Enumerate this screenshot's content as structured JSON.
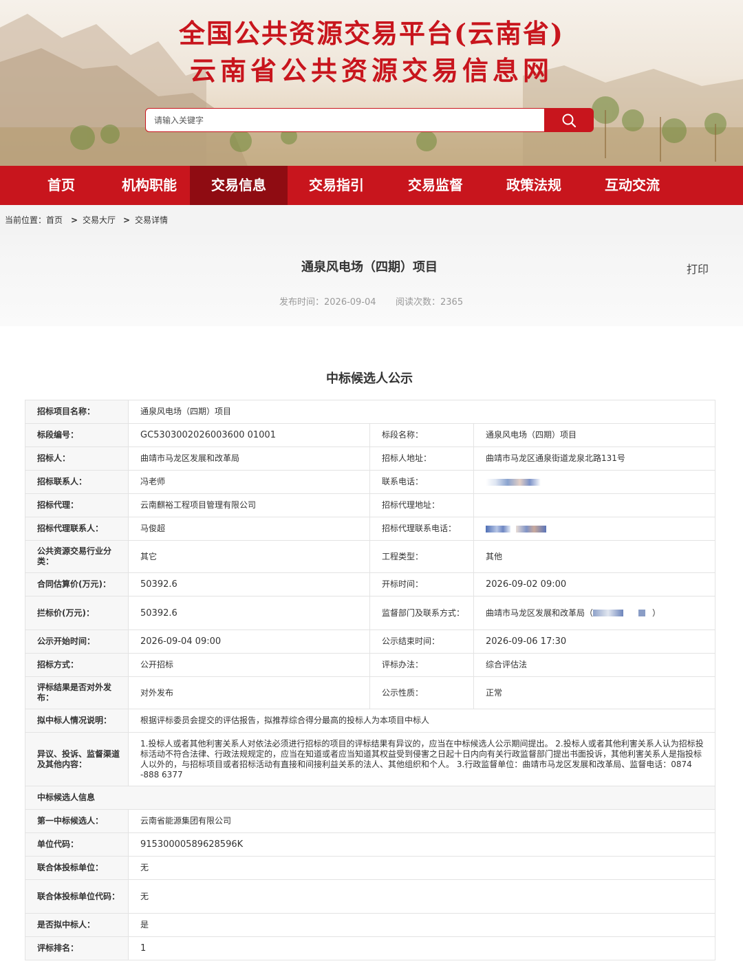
{
  "header": {
    "title_line1": "全国公共资源交易平台(云南省)",
    "title_line2": "云南省公共资源交易信息网",
    "search_placeholder": "请输入关键字",
    "search_icon": "search-icon"
  },
  "colors": {
    "brand_red": "#c8151d",
    "nav_active": "#8f0c12"
  },
  "nav": [
    "首页",
    "机构职能",
    "交易信息",
    "交易指引",
    "交易监督",
    "政策法规",
    "互动交流"
  ],
  "nav_active": "交易信息",
  "breadcrumb": {
    "prefix": "当前位置：首页",
    "sep": ">",
    "item1": "交易大厅",
    "item2": "交易详情"
  },
  "article": {
    "title": "通泉风电场（四期）项目",
    "print": "打印",
    "publish": "发布时间：2026-09-04",
    "reads": "阅读次数：2365"
  },
  "section_title": "中标候选人公示",
  "table": {
    "r1": {
      "label": "招标项目名称：",
      "value": "通泉风电场（四期）项目"
    },
    "r2": {
      "label1": "标段编号：",
      "value1": "GC5303002026003600 01001",
      "label2": "标段名称：",
      "value2": "通泉风电场（四期）项目"
    },
    "r3": {
      "label1": "招标人：",
      "value1": "曲靖市马龙区发展和改革局",
      "label2": "招标人地址：",
      "value2": "曲靖市马龙区通泉街道龙泉北路131号"
    },
    "r4": {
      "label1": "招标联系人：",
      "value1": "冯老师",
      "label2": "联系电话："
    },
    "r5": {
      "label1": "招标代理：",
      "value1": "云南麒裕工程项目管理有限公司",
      "label2": "招标代理地址："
    },
    "r6": {
      "label1": "招标代理联系人：",
      "value1": "马俊超",
      "label2": "招标代理联系电话："
    },
    "r7": {
      "label1": "公共资源交易行业分类：",
      "value1": "其它",
      "label2": "工程类型：",
      "value2": "其他"
    },
    "r8": {
      "label1": "合同估算价(万元)：",
      "value1": "50392.6",
      "label2": "开标时间：",
      "value2": "2026-09-02 09:00"
    },
    "r9": {
      "label1": "拦标价(万元)：",
      "value1": "50392.6",
      "label2": "监督部门及联系方式：",
      "value2a": "曲靖市马龙区发展和改革局（",
      "value2b": "）"
    },
    "r10": {
      "label1": "公示开始时间：",
      "value1": "2026-09-04 09:00",
      "label2": "公示结束时间：",
      "value2": "2026-09-06 17:30"
    },
    "r11": {
      "label1": "招标方式：",
      "value1": "公开招标",
      "label2": "评标办法：",
      "value2": "综合评估法"
    },
    "r12": {
      "label1": "评标结果是否对外发布：",
      "value1": "对外发布",
      "label2": "公示性质：",
      "value2": "正常"
    },
    "r13": {
      "label": "拟中标人情况说明：",
      "value": "根据评标委员会提交的评估报告，拟推荐综合得分最高的投标人为本项目中标人"
    },
    "r14": {
      "label": "异议、投诉、监督渠道及其他内容：",
      "value": "1.投标人或者其他利害关系人对依法必须进行招标的项目的评标结果有异议的，应当在中标候选人公示期间提出。 2.投标人或者其他利害关系人认为招标投标活动不符合法律、行政法规规定的，应当在知道或者应当知道其权益受到侵害之日起十日内向有关行政监督部门提出书面投诉，其他利害关系人是指投标人以外的，与招标项目或者招标活动有直接和间接利益关系的法人、其他组织和个人。 3.行政监督单位：曲靖市马龙区发展和改革局、监督电话：0874 -888 6377"
    },
    "r15": {
      "label": "中标候选人信息"
    },
    "r16": {
      "label": "第一中标候选人：",
      "value": "云南省能源集团有限公司"
    },
    "r17": {
      "label": "单位代码：",
      "value": "91530000589628596K"
    },
    "r18": {
      "label": "联合体投标单位：",
      "value": "无"
    },
    "r19": {
      "label": "联合体投标单位代码：",
      "value": "无"
    },
    "r20": {
      "label": "是否拟中标人：",
      "value": "是"
    },
    "r21": {
      "label": "评标排名：",
      "value": "1"
    }
  }
}
